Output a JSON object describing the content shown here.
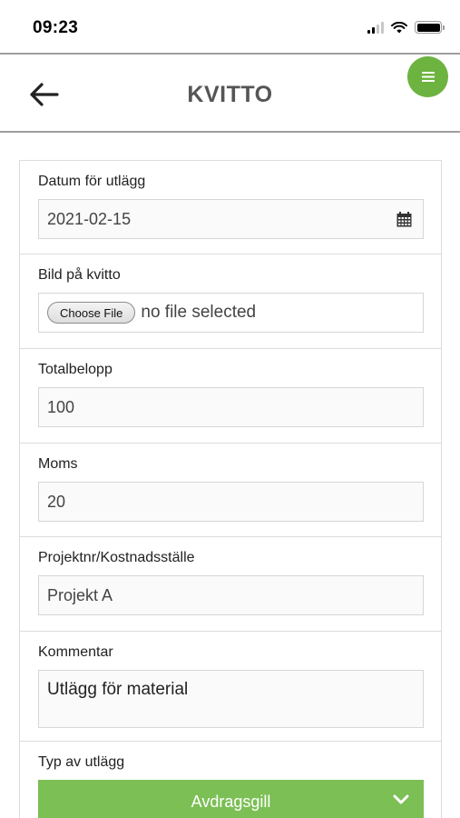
{
  "status_bar": {
    "time": "09:23"
  },
  "header": {
    "title": "KVITTO"
  },
  "form": {
    "date": {
      "label": "Datum för utlägg",
      "value": "2021-02-15"
    },
    "receipt_image": {
      "label": "Bild på kvitto",
      "button_label": "Choose File",
      "file_status": "no file selected"
    },
    "total": {
      "label": "Totalbelopp",
      "value": "100"
    },
    "vat": {
      "label": "Moms",
      "value": "20"
    },
    "project": {
      "label": "Projektnr/Kostnadsställe",
      "value": "Projekt A"
    },
    "comment": {
      "label": "Kommentar",
      "value": "Utlägg för material"
    },
    "expense_type": {
      "label": "Typ av utlägg",
      "selected": "Avdragsgill"
    }
  },
  "colors": {
    "accent_green": "#6db33f",
    "select_green": "#7bbf55",
    "title_gray": "#555555"
  },
  "icons": [
    "back-arrow-icon",
    "hamburger-menu-icon",
    "calendar-icon",
    "chevron-down-icon",
    "wifi-icon",
    "signal-icon",
    "battery-icon"
  ]
}
